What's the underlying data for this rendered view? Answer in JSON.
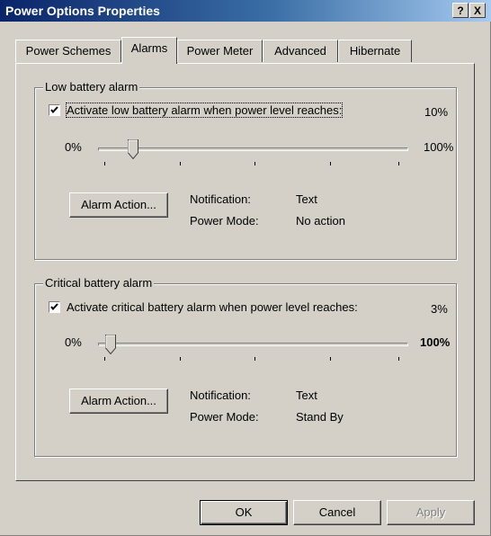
{
  "window": {
    "title": "Power Options Properties",
    "help_label": "?",
    "close_label": "X"
  },
  "tabs": [
    {
      "label": "Power Schemes",
      "active": false
    },
    {
      "label": "Alarms",
      "active": true
    },
    {
      "label": "Power Meter",
      "active": false
    },
    {
      "label": "Advanced",
      "active": false
    },
    {
      "label": "Hibernate",
      "active": false
    }
  ],
  "low_battery": {
    "group_label": "Low battery alarm",
    "checkbox_label": "Activate low battery alarm when power level reaches:",
    "checked": true,
    "value_label": "10%",
    "level_percent": 10,
    "slider_min_label": "0%",
    "slider_max_label": "100%",
    "alarm_button_label": "Alarm Action...",
    "notification_label": "Notification:",
    "notification_value": "Text",
    "power_mode_label": "Power Mode:",
    "power_mode_value": "No action"
  },
  "critical_battery": {
    "group_label": "Critical battery alarm",
    "checkbox_label": "Activate critical battery alarm when power level reaches:",
    "checked": true,
    "value_label": "3%",
    "level_percent": 3,
    "slider_min_label": "0%",
    "slider_max_label": "100%",
    "alarm_button_label": "Alarm Action...",
    "notification_label": "Notification:",
    "notification_value": "Text",
    "power_mode_label": "Power Mode:",
    "power_mode_value": "Stand By"
  },
  "footer": {
    "ok_label": "OK",
    "cancel_label": "Cancel",
    "apply_label": "Apply"
  }
}
